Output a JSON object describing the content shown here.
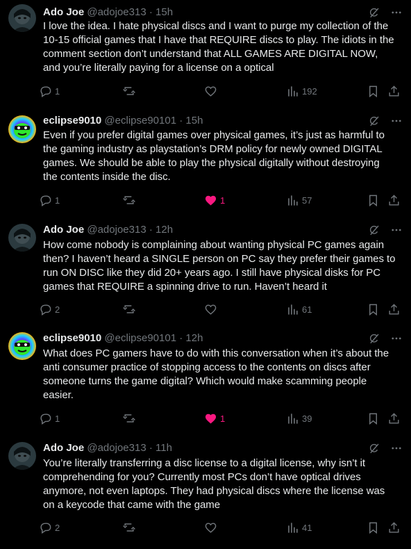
{
  "colors": {
    "background": "#000000",
    "text": "#e7e9ea",
    "muted": "#71767b",
    "like_active": "#f91880"
  },
  "icons": {
    "grok": "grok-icon",
    "more": "more-icon",
    "reply": "reply-icon",
    "repost": "repost-icon",
    "like": "like-icon",
    "views": "views-icon",
    "bookmark": "bookmark-icon",
    "share": "share-icon"
  },
  "posts": [
    {
      "name": "Ado Joe",
      "handle": "@adojoe313",
      "dot": "·",
      "time": "15h",
      "text": "I love the idea. I hate physical discs and I want to purge my collection of the\n10-15 official games that I have that REQUIRE discs to play. The idiots in the\ncomment section don’t understand that ALL GAMES ARE DIGITAL NOW,\nand you’re literally paying for a license on a optical",
      "replies": "1",
      "reposts": "",
      "likes": "",
      "liked": false,
      "views": "192"
    },
    {
      "name": "eclipse9010",
      "handle": "@eclipse90101",
      "dot": "·",
      "time": "15h",
      "text": "Even if you prefer digital games over physical games, it’s just as harmful to\nthe gaming industry as playstation’s DRM policy for newly owned DIGITAL\ngames. We should be able to play the physical digitally without destroying\nthe contents inside the disc.",
      "replies": "1",
      "reposts": "",
      "likes": "1",
      "liked": true,
      "views": "57"
    },
    {
      "name": "Ado Joe",
      "handle": "@adojoe313",
      "dot": "·",
      "time": "12h",
      "text": "How come nobody is complaining about wanting physical PC games again\nthen? I haven’t heard a SINGLE person on PC say they prefer their games to\nrun ON DISC like they did 20+ years ago. I still have physical disks for PC\ngames that REQUIRE a spinning drive to run. Haven’t heard it",
      "replies": "2",
      "reposts": "",
      "likes": "",
      "liked": false,
      "views": "61"
    },
    {
      "name": "eclipse9010",
      "handle": "@eclipse90101",
      "dot": "·",
      "time": "12h",
      "text": "What does PC gamers have to do with this conversation when it’s about the\nanti consumer practice of stopping access to the contents on discs after\nsomeone turns the game digital? Which would make scamming people\neasier.",
      "replies": "1",
      "reposts": "",
      "likes": "1",
      "liked": true,
      "views": "39"
    },
    {
      "name": "Ado Joe",
      "handle": "@adojoe313",
      "dot": "·",
      "time": "11h",
      "text": "You’re literally transferring a disc license to a digital license, why isn’t it\ncomprehending for you? Currently most PCs don’t have optical drives\nanymore, not even laptops. They had physical discs where the license was\non a keycode that came with the game",
      "replies": "2",
      "reposts": "",
      "likes": "",
      "liked": false,
      "views": "41"
    }
  ]
}
